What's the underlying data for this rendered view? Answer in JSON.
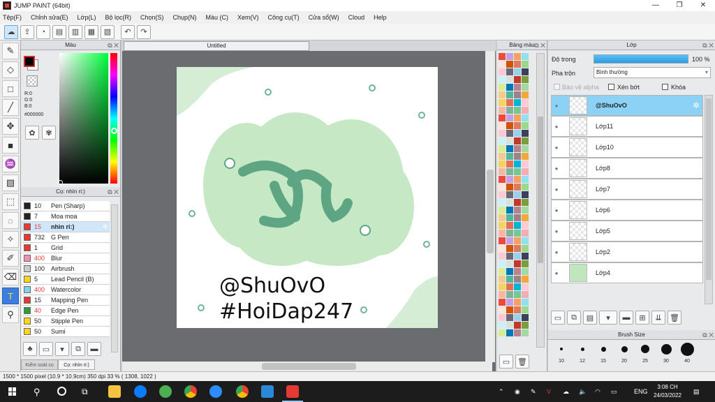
{
  "window": {
    "title": "JUMP PAINT (64bit)",
    "min": "—",
    "max": "❐",
    "close": "✕"
  },
  "menu": [
    "Tệp(F)",
    "Chỉnh sửa(E)",
    "Lớp(L)",
    "Bộ lọc(R)",
    "Chọn(S)",
    "Chụp(N)",
    "Màu (C)",
    "Xem(V)",
    "Công cụ(T)",
    "Cửa sổ(W)",
    "Cloud",
    "Help"
  ],
  "color_panel": {
    "title": "Màu",
    "r": "R:0",
    "g": "G:0",
    "b": "B:0",
    "hex": "#000000",
    "fg": "#000000",
    "bg": "#ffffff"
  },
  "brush_panel": {
    "title": "Cọ: nhìn ri:)",
    "items": [
      {
        "size": "10",
        "name": "Pen (Sharp)",
        "color": "#222222",
        "sizecolor": "#222222"
      },
      {
        "size": "7",
        "name": "Moa moa",
        "color": "#222222",
        "sizecolor": "#222222"
      },
      {
        "size": "15",
        "name": "nhìn ri:)",
        "color": "#e53935",
        "sizecolor": "#e53935"
      },
      {
        "size": "732",
        "name": "G Pen",
        "color": "#e53935",
        "sizecolor": "#222222"
      },
      {
        "size": "1",
        "name": "Grid",
        "color": "#e53935",
        "sizecolor": "#222222"
      },
      {
        "size": "400",
        "name": "Blur",
        "color": "#f48fb1",
        "sizecolor": "#e53935"
      },
      {
        "size": "100",
        "name": "Airbrush",
        "color": "#cccccc",
        "sizecolor": "#222222"
      },
      {
        "size": "5",
        "name": "Lead Pencil (B)",
        "color": "#f9d71c",
        "sizecolor": "#222222"
      },
      {
        "size": "400",
        "name": "Watercolor",
        "color": "#7fd4f5",
        "sizecolor": "#e53935"
      },
      {
        "size": "15",
        "name": "Mapping Pen",
        "color": "#e53935",
        "sizecolor": "#222222"
      },
      {
        "size": "40",
        "name": "Edge Pen",
        "color": "#2e9e3b",
        "sizecolor": "#e53935"
      },
      {
        "size": "50",
        "name": "Stipple Pen",
        "color": "#f9d71c",
        "sizecolor": "#222222"
      },
      {
        "size": "50",
        "name": "Sumi",
        "color": "#f9d71c",
        "sizecolor": "#222222"
      }
    ],
    "tab1": "Kiểm soát cọ",
    "tab2": "Cọ: nhìn ri:)"
  },
  "canvas": {
    "tab": "Untitled",
    "text1": "@ShuOvO",
    "text2": "#HoiDap247"
  },
  "swatch_panel": {
    "title": "Bảng màu"
  },
  "layers_panel": {
    "title": "Lớp",
    "opacity_label": "Độ trong",
    "opacity_value": "100 %",
    "blend_label": "Pha trộn",
    "blend_value": "Bình thường",
    "protect_alpha": "Bảo vệ alpha",
    "clip": "Xén bớt",
    "lock": "Khóa",
    "layers": [
      "@ShuOvO",
      "Lớp11",
      "Lớp10",
      "Lớp8",
      "Lớp7",
      "Lớp6",
      "Lớp5",
      "Lớp2",
      "Lớp4"
    ]
  },
  "brush_size": {
    "title": "Brush Size",
    "sizes": [
      "10",
      "12",
      "15",
      "20",
      "25",
      "30",
      "40"
    ]
  },
  "status": "1500 * 1500 pixel   (10.9 * 10.9cm)   350 dpi   33 %   ( 1308, 1022 )",
  "taskbar": {
    "lang": "ENG",
    "time": "3:08 CH",
    "date": "24/03/2022"
  }
}
